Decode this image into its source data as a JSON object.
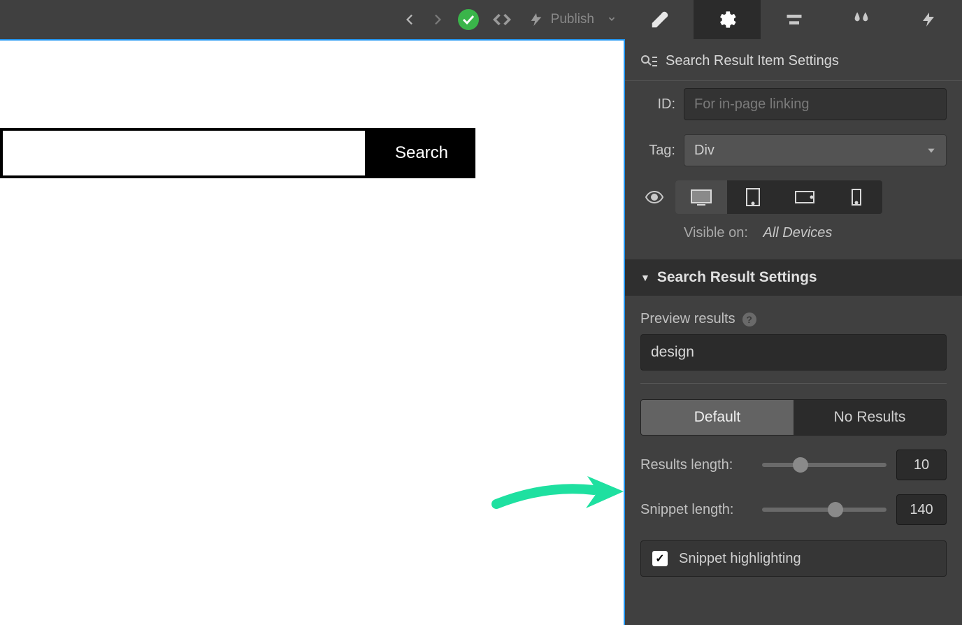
{
  "topbar": {
    "publish_label": "Publish"
  },
  "canvas": {
    "search_button": "Search"
  },
  "panel": {
    "header": "Search Result Item Settings",
    "id_label": "ID:",
    "id_placeholder": "For in-page linking",
    "tag_label": "Tag:",
    "tag_value": "Div",
    "visible_label": "Visible on:",
    "visible_value": "All Devices",
    "section_title": "Search Result Settings",
    "preview_label": "Preview results",
    "preview_value": "design",
    "toggle_default": "Default",
    "toggle_noresults": "No Results",
    "results_length_label": "Results length:",
    "results_length_value": "10",
    "snippet_length_label": "Snippet length:",
    "snippet_length_value": "140",
    "snippet_highlighting": "Snippet highlighting"
  }
}
